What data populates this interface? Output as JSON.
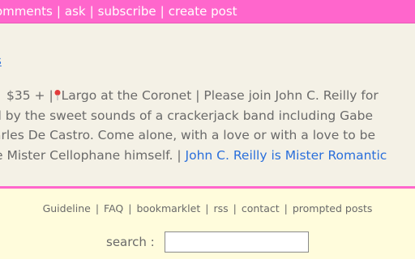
{
  "header": {
    "nav": [
      "omments",
      "ask",
      "subscribe",
      "create post"
    ],
    "separator": "|"
  },
  "content": {
    "stray_link": "s",
    "post": {
      "line1_price": "$35 +",
      "line1_sep": "|",
      "line1_location": "Largo at the Coronet",
      "line1_text": "| Please join John C. Reilly for",
      "line2": "d by the sweet sounds of a crackerjack band including Gabe",
      "line3": "arles De Castro. Come alone, with a love or with a love to be",
      "line4_text": "e Mister Cellophane himself. |",
      "link": "John C. Reilly is Mister Romantic"
    }
  },
  "footer": {
    "links": [
      "Guideline",
      "FAQ",
      "bookmarklet",
      "rss",
      "contact",
      "prompted posts"
    ],
    "separator": "|",
    "search_label": "search :",
    "search_value": "",
    "search_placeholder": ""
  },
  "colors": {
    "accent": "#ff66cc",
    "link": "#2a6fdb",
    "footer_bg": "#fffcdc",
    "content_bg": "#f4f1e6"
  },
  "icons": {
    "location": "map-pin-icon"
  }
}
